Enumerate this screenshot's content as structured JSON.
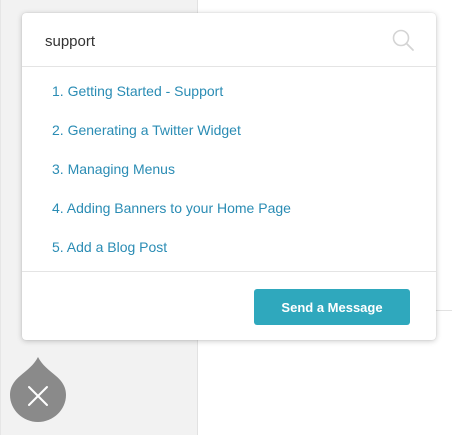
{
  "search": {
    "value": "support",
    "placeholder": "",
    "icon": "search-icon"
  },
  "results": [
    {
      "label": "1. Getting Started - Support"
    },
    {
      "label": "2. Generating a Twitter Widget"
    },
    {
      "label": "3. Managing Menus"
    },
    {
      "label": "4. Adding Banners to your Home Page"
    },
    {
      "label": "5. Add a Blog Post"
    }
  ],
  "footer": {
    "send_label": "Send a Message"
  },
  "launcher": {
    "icon": "close-icon"
  },
  "colors": {
    "link": "#2a8cb4",
    "button": "#2fa8bd",
    "launcher": "#8a8a8a"
  }
}
